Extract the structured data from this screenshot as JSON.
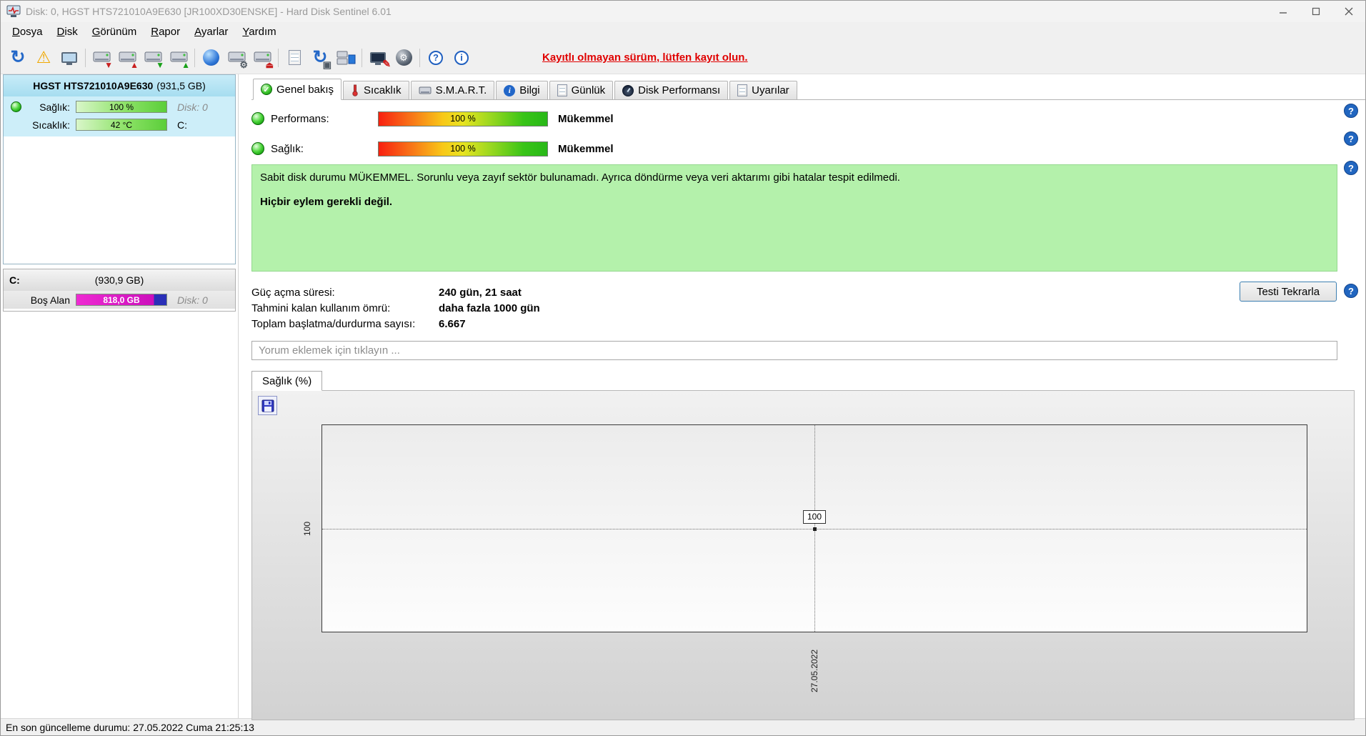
{
  "window": {
    "title": "Disk: 0, HGST HTS721010A9E630 [JR100XD30ENSKE]  -  Hard Disk Sentinel 6.01"
  },
  "menu": {
    "items": [
      {
        "label": "Dosya"
      },
      {
        "label": "Disk"
      },
      {
        "label": "Görünüm"
      },
      {
        "label": "Rapor"
      },
      {
        "label": "Ayarlar"
      },
      {
        "label": "Yardım"
      }
    ]
  },
  "toolbar": {
    "register_notice": "Kayıtlı olmayan sürüm, lütfen kayıt olun."
  },
  "sidebar": {
    "disk": {
      "name": "HGST HTS721010A9E630",
      "size": "(931,5 GB)",
      "health_label": "Sağlık:",
      "health_value": "100 %",
      "health_disk": "Disk: 0",
      "temp_label": "Sıcaklık:",
      "temp_value": "42 °C",
      "temp_drive": "C:"
    },
    "partition": {
      "name": "C:",
      "size": "(930,9 GB)",
      "free_label": "Boş Alan",
      "free_value": "818,0 GB",
      "disk": "Disk: 0"
    }
  },
  "tabs": [
    {
      "label": "Genel bakış"
    },
    {
      "label": "Sıcaklık"
    },
    {
      "label": "S.M.A.R.T."
    },
    {
      "label": "Bilgi"
    },
    {
      "label": "Günlük"
    },
    {
      "label": "Disk Performansı"
    },
    {
      "label": "Uyarılar"
    }
  ],
  "overview": {
    "performance_label": "Performans:",
    "performance_value": "100 %",
    "performance_text": "Mükemmel",
    "health_label": "Sağlık:",
    "health_value": "100 %",
    "health_text": "Mükemmel",
    "status_text": "Sabit disk durumu MÜKEMMEL. Sorunlu veya zayıf sektör bulunamadı. Ayrıca döndürme veya veri aktarımı gibi hatalar tespit edilmedi.",
    "action_text": "Hiçbir eylem gerekli değil.",
    "stats": [
      {
        "label": "Güç açma süresi:",
        "value": "240 gün, 21 saat"
      },
      {
        "label": "Tahmini kalan kullanım ömrü:",
        "value": "daha fazla 1000 gün"
      },
      {
        "label": "Toplam başlatma/durdurma sayısı:",
        "value": "6.667"
      }
    ],
    "retest_button": "Testi Tekrarla",
    "comment_placeholder": "Yorum eklemek için tıklayın ..."
  },
  "chart_data": {
    "type": "line",
    "title": "Sağlık (%)",
    "x": [
      "27.05.2022"
    ],
    "series": [
      {
        "name": "Sağlık (%)",
        "values": [
          100
        ]
      }
    ],
    "yticks": [
      100
    ],
    "grid": "dotted-crosshair",
    "legend": "none"
  },
  "statusbar": {
    "text": "En son güncelleme durumu: 27.05.2022 Cuma 21:25:13"
  }
}
